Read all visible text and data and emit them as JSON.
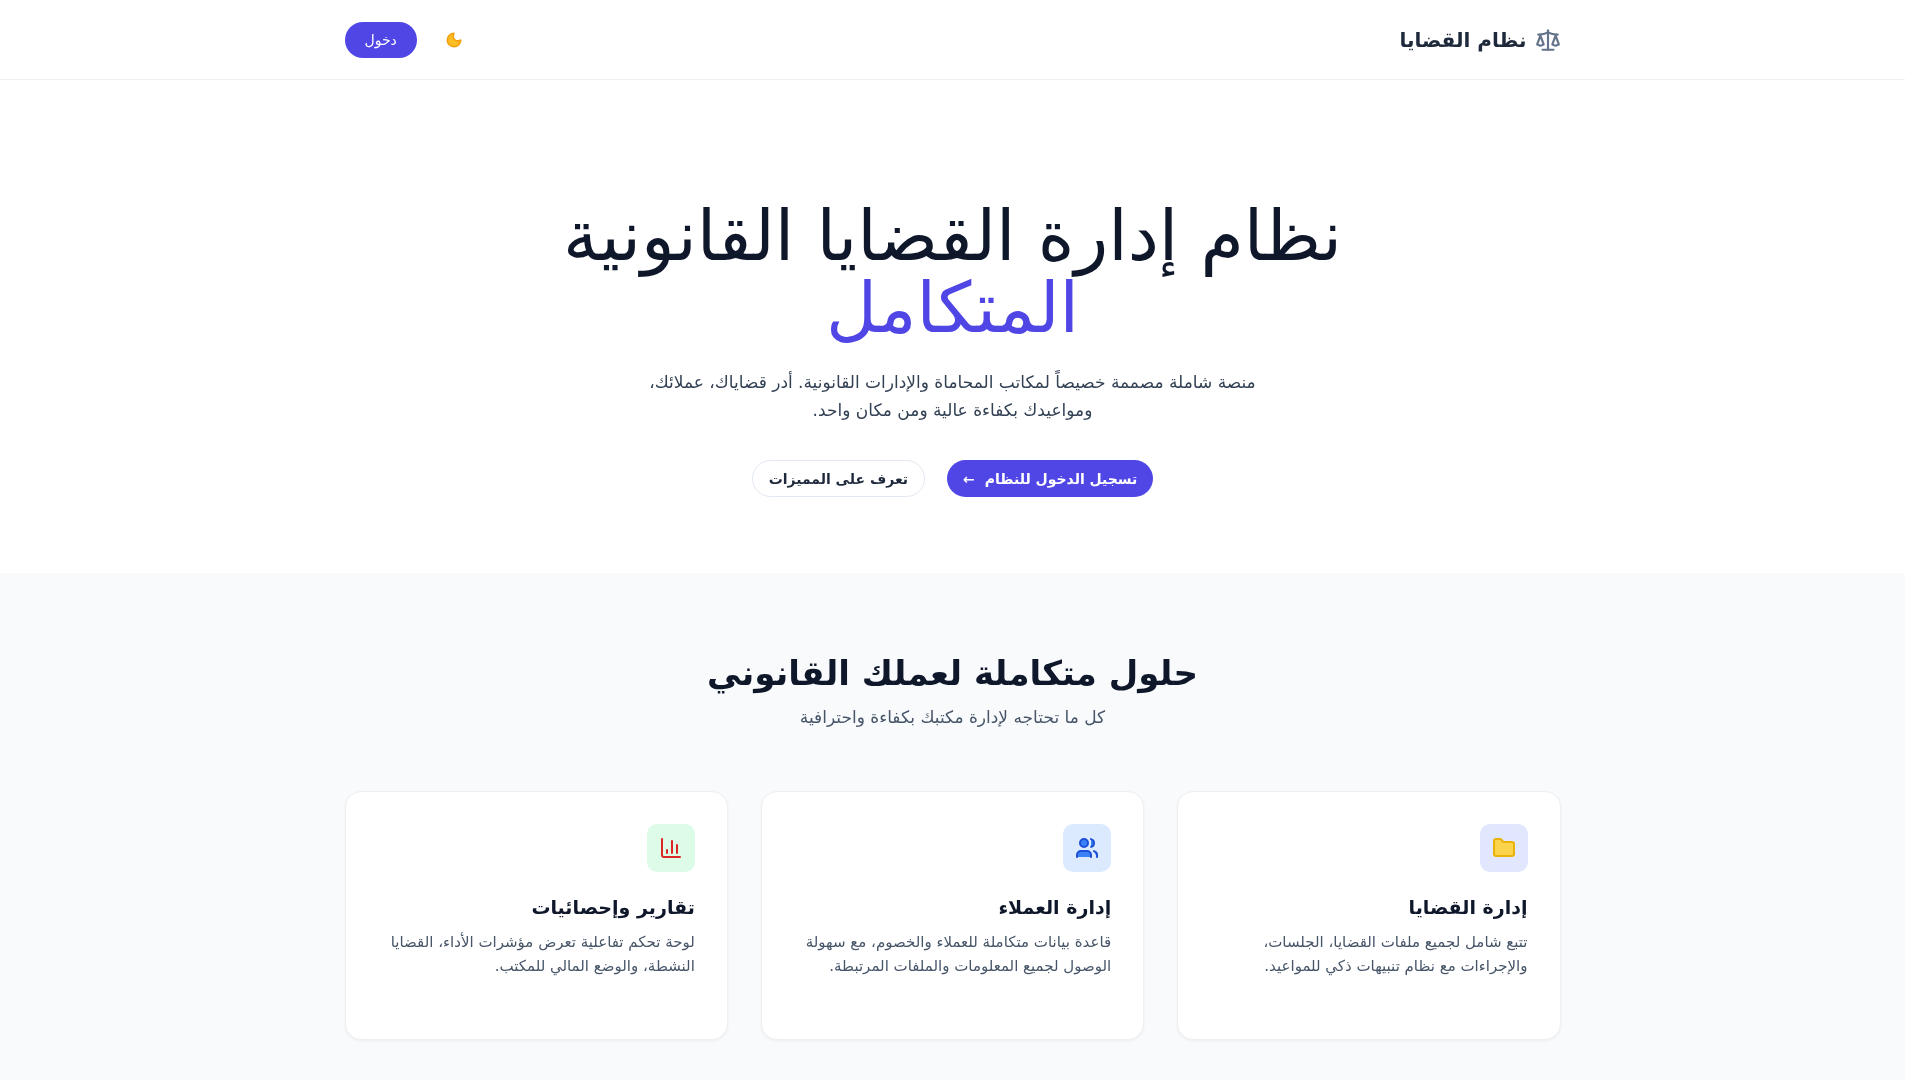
{
  "header": {
    "brand": "نظام القضايا",
    "login_button": "دخول"
  },
  "hero": {
    "title": "نظام إدارة القضايا القانونية",
    "title_accent": "المتكامل",
    "description": "منصة شاملة مصممة خصيصاً لمكاتب المحاماة والإدارات القانونية. أدر قضاياك، عملائك، ومواعيدك بكفاءة عالية ومن مكان واحد.",
    "primary_button": {
      "label": "تسجيل الدخول للنظام",
      "arrow": "←"
    },
    "secondary_button": "تعرف على المميزات"
  },
  "features": {
    "title": "حلول متكاملة لعملك القانوني",
    "subtitle": "كل ما تحتاجه لإدارة مكتبك بكفاءة واحترافية",
    "cards": [
      {
        "kind": "folder",
        "color": "#e0e7ff",
        "title": "إدارة القضايا",
        "description": "تتبع شامل لجميع ملفات القضايا، الجلسات، والإجراءات مع نظام تنبيهات ذكي للمواعيد."
      },
      {
        "kind": "users",
        "color": "#dbeafe",
        "title": "إدارة العملاء",
        "description": "قاعدة بيانات متكاملة للعملاء والخصوم، مع سهولة الوصول لجميع المعلومات والملفات المرتبطة."
      },
      {
        "kind": "chart",
        "color": "#dcfce7",
        "title": "تقارير وإحصائيات",
        "description": "لوحة تحكم تفاعلية تعرض مؤشرات الأداء، القضايا النشطة، والوضع المالي للمكتب."
      }
    ]
  }
}
